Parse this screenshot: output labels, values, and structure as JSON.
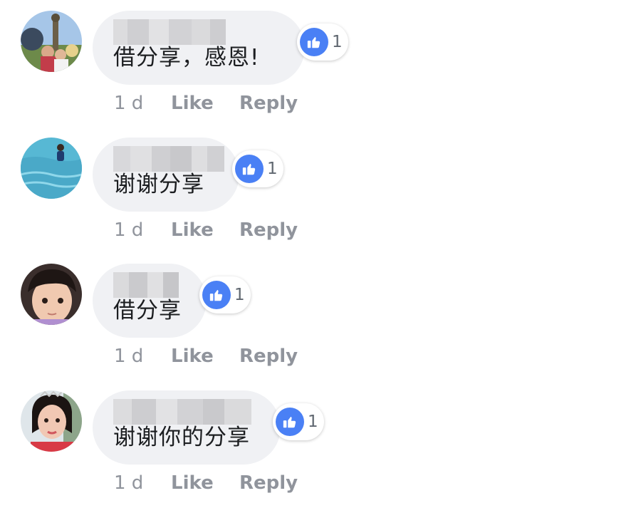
{
  "colors": {
    "bubble_bg": "#f0f1f4",
    "like_blue": "#4a80f5",
    "meta_gray": "#90949c",
    "text": "#1c1e21"
  },
  "comments": [
    {
      "text": "借分享，感恩!",
      "reaction_icon": "thumbs-up-icon",
      "reaction_count": "1",
      "timestamp": "1 d",
      "like_label": "Like",
      "reply_label": "Reply"
    },
    {
      "text": "谢谢分享",
      "reaction_icon": "thumbs-up-icon",
      "reaction_count": "1",
      "timestamp": "1 d",
      "like_label": "Like",
      "reply_label": "Reply"
    },
    {
      "text": "借分享",
      "reaction_icon": "thumbs-up-icon",
      "reaction_count": "1",
      "timestamp": "1 d",
      "like_label": "Like",
      "reply_label": "Reply"
    },
    {
      "text": "谢谢你的分享",
      "reaction_icon": "thumbs-up-icon",
      "reaction_count": "1",
      "timestamp": "1 d",
      "like_label": "Like",
      "reply_label": "Reply"
    }
  ]
}
